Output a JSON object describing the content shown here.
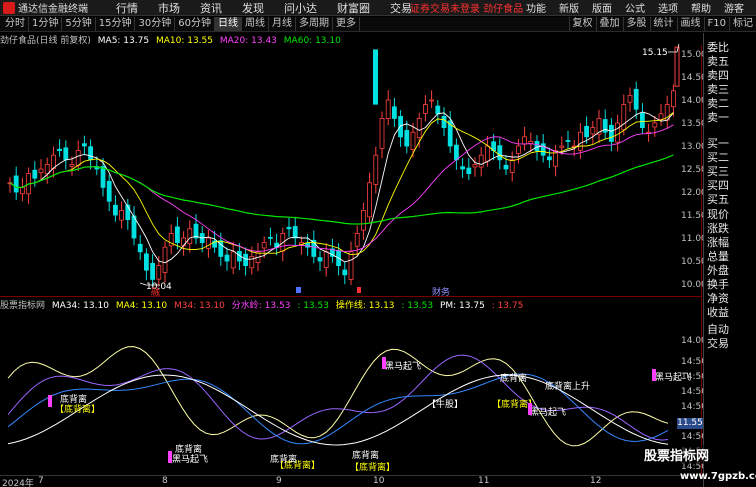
{
  "app": {
    "name": "通达信金融终端",
    "menu": [
      "行情",
      "市场",
      "资讯",
      "发现",
      "问小达",
      "财富圈",
      "交易"
    ],
    "notice": "证券交易未登录  劲仔食品",
    "right_menu": [
      "功能",
      "新版",
      "版面",
      "公式",
      "选项",
      "帮助",
      "游客"
    ]
  },
  "toolbar": {
    "periods": [
      "分时",
      "1分钟",
      "5分钟",
      "15分钟",
      "30分钟",
      "60分钟",
      "日线",
      "周线",
      "月线",
      "多周期",
      "更多"
    ],
    "active": "日线",
    "right_buttons": [
      "复权",
      "叠加",
      "多股",
      "统计",
      "画线",
      "F10",
      "标记"
    ]
  },
  "price_panel": {
    "title": "劲仔食品(日线 前复权)",
    "ma": [
      {
        "label": "MA5: 13.75",
        "color": "#ffffff"
      },
      {
        "label": "MA10: 13.55",
        "color": "#ffff00"
      },
      {
        "label": "MA20: 13.43",
        "color": "#ff40ff"
      },
      {
        "label": "MA60: 13.10",
        "color": "#00e600"
      }
    ],
    "high_label": "15.15",
    "low_label": "10.04",
    "axis": [
      "15.00",
      "14.50",
      "14.00",
      "13.50",
      "13.00",
      "12.50",
      "12.00",
      "11.50",
      "11.00",
      "10.50",
      "10.00"
    ],
    "markers": [
      "融",
      "财务"
    ]
  },
  "indicator_panel": {
    "title": "股票指标网",
    "values": [
      {
        "label": "MA34: 13.10",
        "color": "#ffffff"
      },
      {
        "label": "MA4: 13.10",
        "color": "#ffff00"
      },
      {
        "label": "M34: 13.10",
        "color": "#ff4040"
      },
      {
        "label": "分水岭: 13.53",
        "color": "#ff40ff"
      },
      {
        "label": ": 13.53",
        "color": "#00e600"
      },
      {
        "label": "操作线: 13.13",
        "color": "#ffff00"
      },
      {
        "label": ": 13.53",
        "color": "#00e600"
      },
      {
        "label": "PM: 13.75",
        "color": "#ffffff"
      },
      {
        "label": ": 13.75",
        "color": "#ff4040"
      }
    ],
    "axis": [
      "14.00",
      "14:50",
      "14:50",
      "14:50",
      "14:50",
      "14:50",
      "14:50",
      "14:50",
      "14:50"
    ],
    "last_price": "11.55",
    "signals": {
      "dibei": "底背离",
      "heima": "黑马起飞",
      "niugu": "【牛股】",
      "dibeili_bracket": "【底背离】",
      "shangsheng": "上升"
    }
  },
  "side_panel": [
    "委比",
    "卖五",
    "卖四",
    "卖三",
    "卖二",
    "卖一",
    "买一",
    "买二",
    "买三",
    "买四",
    "买五",
    "现价",
    "涨跌",
    "涨幅",
    "总量",
    "外盘",
    "换手",
    "净资",
    "收益",
    "自动",
    "交易"
  ],
  "dates": [
    "2024年",
    "7",
    "8",
    "9",
    "10",
    "11",
    "12"
  ],
  "watermark": {
    "line1": "股票指标网",
    "line2": "www.7gpzb.com"
  }
}
